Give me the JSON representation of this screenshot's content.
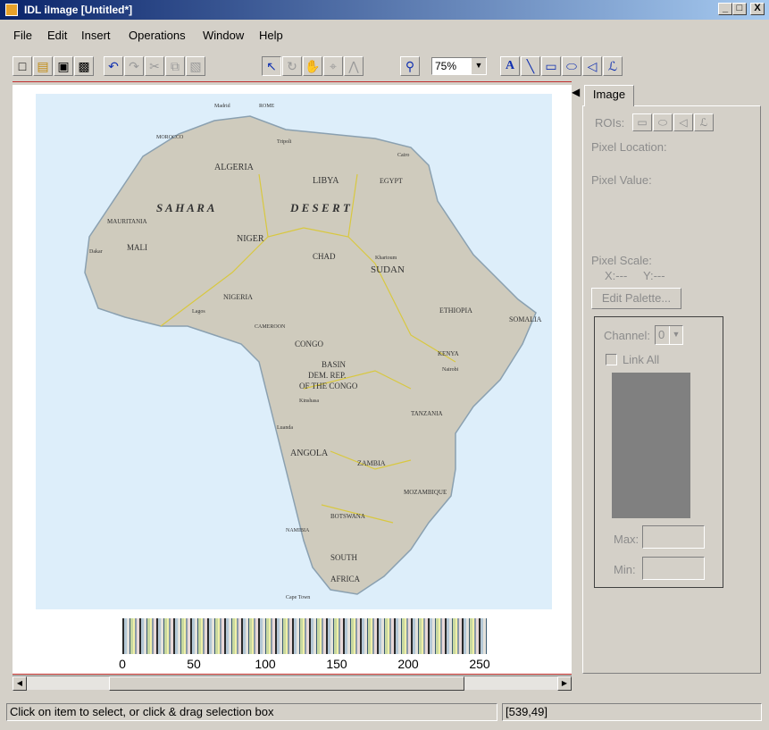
{
  "window": {
    "title": "IDL iImage [Untitled*]",
    "minimize": "_",
    "maximize": "□",
    "close": "X"
  },
  "menu": [
    "File",
    "Edit",
    "Insert",
    "Operations",
    "Window",
    "Help"
  ],
  "toolbar": {
    "zoom_value": "75%"
  },
  "colorbar": {
    "ticks": [
      "0",
      "50",
      "100",
      "150",
      "200",
      "250"
    ]
  },
  "map_labels": {
    "algeria": "ALGERIA",
    "libya": "LIBYA",
    "egypt": "EGYPT",
    "sahara": "S A H A R A",
    "desert": "D E S E R T",
    "mauritania": "MAURITANIA",
    "mali": "MALI",
    "niger": "NIGER",
    "chad": "CHAD",
    "sudan": "SUDAN",
    "nigeria": "NIGERIA",
    "ethiopia": "ETHIOPIA",
    "somalia": "SOMALIA",
    "congo": "CONGO",
    "basin": "BASIN",
    "dem_rep": "DEM. REP.",
    "of_congo": "OF THE CONGO",
    "kenya": "KENYA",
    "tanzania": "TANZANIA",
    "angola": "ANGOLA",
    "zambia": "ZAMBIA",
    "mozambique": "MOZAMBIQUE",
    "botswana": "BOTSWANA",
    "namibia": "NAMIBIA",
    "south": "SOUTH",
    "africa": "AFRICA",
    "morocco": "MOROCCO",
    "cameroon": "CAMEROON",
    "madrid": "Madrid",
    "rome": "ROME",
    "cairo": "Cairo",
    "tripoli": "Tripoli",
    "khartoum": "Khartoum",
    "nairobi": "Nairobi",
    "kinshasa": "Kinshasa",
    "lagos": "Lagos",
    "dakar": "Dakar",
    "capetown": "Cape Town",
    "luanda": "Luanda"
  },
  "panel": {
    "tab_label": "Image",
    "rois_label": "ROIs:",
    "pixel_location": "Pixel Location:",
    "pixel_value": "Pixel Value:",
    "pixel_scale": "Pixel Scale:",
    "x_scale": "X:---",
    "y_scale": "Y:---",
    "edit_palette": "Edit Palette...",
    "channel_label": "Channel:",
    "channel_value": "0",
    "link_all": "Link All",
    "max_label": "Max:",
    "min_label": "Min:"
  },
  "status": {
    "message": "Click on item to select, or click & drag selection box",
    "coords": "[539,49]"
  }
}
